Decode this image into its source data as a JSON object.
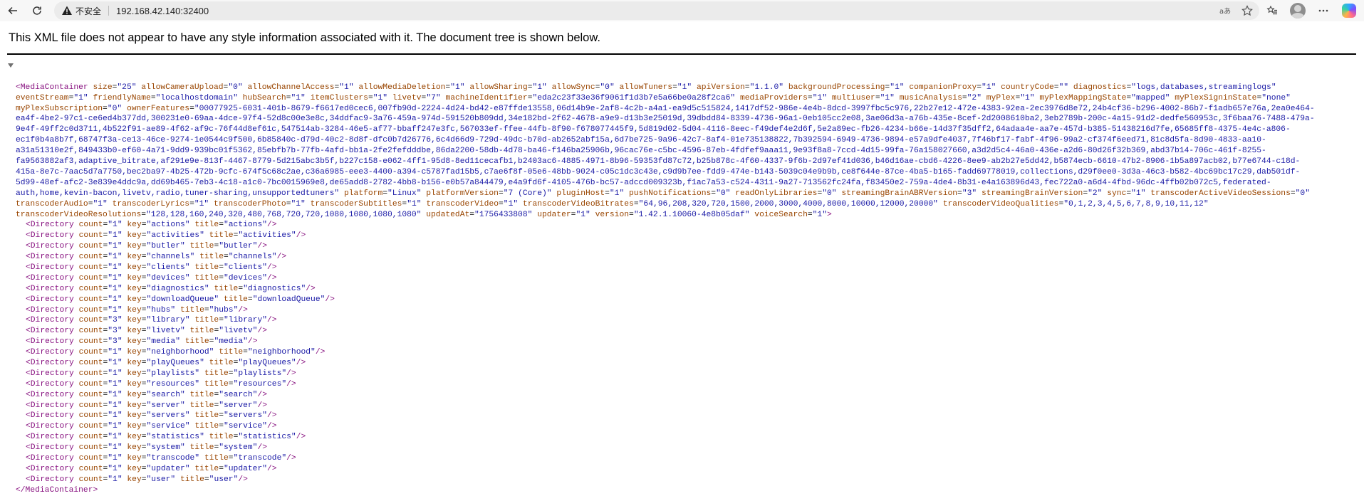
{
  "browser": {
    "insecure_label": "不安全",
    "url": "192.168.42.140:32400",
    "icons": [
      "back-arrow-icon",
      "reload-icon",
      "warning-triangle-icon",
      "read-aloud-icon",
      "favorite-star-icon",
      "collections-icon",
      "profile-avatar-icon",
      "more-menu-icon",
      "copilot-icon"
    ]
  },
  "page": {
    "header_text": "This XML file does not appear to have any style information associated with it. The document tree is shown below.",
    "xml_lines": [
      "<MediaContainer size=\"25\" allowCameraUpload=\"0\" allowChannelAccess=\"1\" allowMediaDeletion=\"1\" allowSharing=\"1\" allowSync=\"0\" allowTuners=\"1\" apiVersion=\"1.1.0\" backgroundProcessing=\"1\" companionProxy=\"1\" countryCode=\"\" diagnostics=\"logs,databases,streaminglogs\"",
      "eventStream=\"1\" friendlyName=\"localhostdomain\" hubSearch=\"1\" itemClusters=\"1\" livetv=\"7\" machineIdentifier=\"eda2c23f33e36f9061f1d3b7e5a66be0a28f2ca6\" mediaProviders=\"1\" multiuser=\"1\" musicAnalysis=\"2\" myPlex=\"1\" myPlexMappingState=\"mapped\" myPlexSigninState=\"none\"",
      "myPlexSubscription=\"0\" ownerFeatures=\"00077925-6031-401b-8679-f6617ed0cec6,007fb90d-2224-4d24-bd42-e87ffde13558,06d14b9e-2af8-4c2b-a4a1-ea9d5c515824,1417df52-986e-4e4b-8dcd-3997fbc5c976,22b27e12-472e-4383-92ea-2ec3976d8e72,24b4cf36-b296-4002-86b7-f1adb657e76a,2ea0e464-",
      "ea4f-4be2-97c1-ce6ed4b377dd,300231e0-69aa-4dce-97f4-52d8c00e3e8c,34ddfac9-3a76-459a-974d-591520b809dd,34e182bd-2f62-4678-a9e9-d13b3e25019d,39dbdd84-8339-4736-96a1-0eb105cc2e08,3ae06d3a-a76b-435e-8cef-2d2008610ba2,3eb2789b-200c-4a15-91d2-dedfe560953c,3f6baa76-7488-479a-",
      "9e4f-49ff2c0d3711,4b522f91-ae89-4f62-af9c-76f44d8ef61c,547514ab-3284-46e5-af77-bbaff247e3fc,567033ef-ffee-44fb-8f90-f678077445f9,5d819d02-5d04-4116-8eec-f49def4e2d6f,5e2a89ec-fb26-4234-b66e-14d37f35dff2,64adaa4e-aa7e-457d-b385-51438216d7fe,65685ff8-4375-4e4c-a806-",
      "ec1f0b4a8b7f,68747f3a-ce13-46ce-9274-1e0544c9f500,6b85840c-d79d-40c2-8d8f-dfc0b7d26776,6c4d66d9-729d-49dc-b70d-ab2652abf15a,6d7be725-9a96-42c7-8af4-01e735138822,7b392594-6949-4736-9894-e57a9dfe4037,7f46bf17-fabf-4f96-99a2-cf374f6eed71,81c8d5fa-8d90-4833-aa10-",
      "a31a51310e2f,849433b0-ef60-4a71-9dd9-939bc01f5362,85ebfb7b-77fb-4afd-bb1a-2fe2fefdddbe,86da2200-58db-4d78-ba46-f146ba25906b,96cac76e-c5bc-4596-87eb-4fdfef9aaa11,9e93f8a8-7ccd-4d15-99fa-76a158027660,a3d2d5c4-46a0-436e-a2d6-80d26f32b369,abd37b14-706c-461f-8255-",
      "fa9563882af3,adaptive_bitrate,af291e9e-813f-4467-8779-5d215abc3b5f,b227c158-e062-4ff1-95d8-8ed11cecafb1,b2403ac6-4885-4971-8b96-59353fd87c72,b25b878c-4f60-4337-9f6b-2d97ef41d036,b46d16ae-cbd6-4226-8ee9-ab2b27e5dd42,b5874ecb-6610-47b2-8906-1b5a897acb02,b77e6744-c18d-",
      "415a-8e7c-7aac5d7a7750,bec2ba97-4b25-472b-9cfc-674f5c68c2ae,c36a6985-eee3-4400-a394-c5787fad15b5,c7ae6f8f-05e6-48bb-9024-c05c1dc3c43e,c9d9b7ee-fdd9-474e-b143-5039c04e9b9b,ce8f644e-87ce-4ba5-b165-fadd69778019,collections,d29f0ee0-3d3a-46c3-b582-4bc69bc17c29,dab501df-",
      "5d99-48ef-afc2-3e839e4ddc9a,dd69b465-7eb3-4c18-a1c0-7bc0015969e8,de65add8-2782-4bb8-b156-e0b57a844479,e4a9fd6f-4105-476b-bc57-adccd009323b,f1ac7a53-c524-4311-9a27-713562fc24fa,f83450e2-759a-4de4-8b31-e4a163896d43,fec722a0-a6d4-4fbd-96dc-4ffb02b072c5,federated-",
      "auth,home,kevin-bacon,livetv,radio,tuner-sharing,unsupportedtuners\" platform=\"Linux\" platformVersion=\"7 (Core)\" pluginHost=\"1\" pushNotifications=\"0\" readOnlyLibraries=\"0\" streamingBrainABRVersion=\"3\" streamingBrainVersion=\"2\" sync=\"1\" transcoderActiveVideoSessions=\"0\"",
      "transcoderAudio=\"1\" transcoderLyrics=\"1\" transcoderPhoto=\"1\" transcoderSubtitles=\"1\" transcoderVideo=\"1\" transcoderVideoBitrates=\"64,96,208,320,720,1500,2000,3000,4000,8000,10000,12000,20000\" transcoderVideoQualities=\"0,1,2,3,4,5,6,7,8,9,10,11,12\"",
      "transcoderVideoResolutions=\"128,128,160,240,320,480,768,720,720,1080,1080,1080,1080\" updatedAt=\"1756433808\" updater=\"1\" version=\"1.42.1.10060-4e8b05daf\" voiceSearch=\"1\">"
    ],
    "directories": [
      {
        "count": "1",
        "key": "actions",
        "title": "actions"
      },
      {
        "count": "1",
        "key": "activities",
        "title": "activities"
      },
      {
        "count": "1",
        "key": "butler",
        "title": "butler"
      },
      {
        "count": "1",
        "key": "channels",
        "title": "channels"
      },
      {
        "count": "1",
        "key": "clients",
        "title": "clients"
      },
      {
        "count": "1",
        "key": "devices",
        "title": "devices"
      },
      {
        "count": "1",
        "key": "diagnostics",
        "title": "diagnostics"
      },
      {
        "count": "1",
        "key": "downloadQueue",
        "title": "downloadQueue"
      },
      {
        "count": "1",
        "key": "hubs",
        "title": "hubs"
      },
      {
        "count": "3",
        "key": "library",
        "title": "library"
      },
      {
        "count": "3",
        "key": "livetv",
        "title": "livetv"
      },
      {
        "count": "3",
        "key": "media",
        "title": "media"
      },
      {
        "count": "1",
        "key": "neighborhood",
        "title": "neighborhood"
      },
      {
        "count": "1",
        "key": "playQueues",
        "title": "playQueues"
      },
      {
        "count": "1",
        "key": "playlists",
        "title": "playlists"
      },
      {
        "count": "1",
        "key": "resources",
        "title": "resources"
      },
      {
        "count": "1",
        "key": "search",
        "title": "search"
      },
      {
        "count": "1",
        "key": "server",
        "title": "server"
      },
      {
        "count": "1",
        "key": "servers",
        "title": "servers"
      },
      {
        "count": "1",
        "key": "service",
        "title": "service"
      },
      {
        "count": "1",
        "key": "statistics",
        "title": "statistics"
      },
      {
        "count": "1",
        "key": "system",
        "title": "system"
      },
      {
        "count": "1",
        "key": "transcode",
        "title": "transcode"
      },
      {
        "count": "1",
        "key": "updater",
        "title": "updater"
      },
      {
        "count": "1",
        "key": "user",
        "title": "user"
      }
    ],
    "closing_tag": "</MediaContainer>"
  }
}
